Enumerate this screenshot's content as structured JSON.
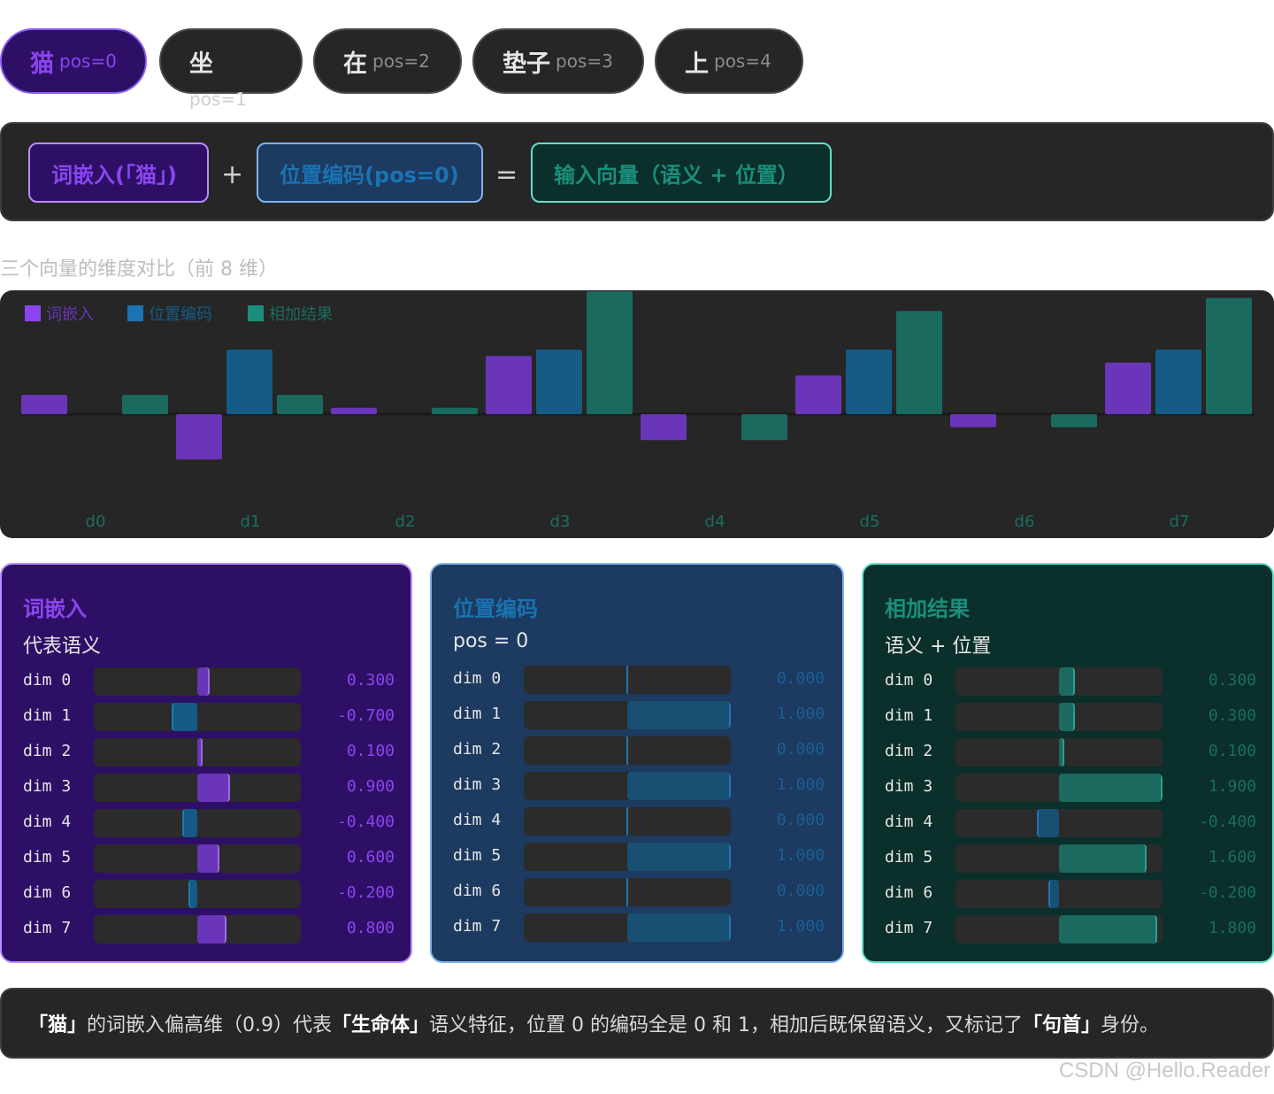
{
  "tokens": [
    {
      "char": "猫",
      "pos": "pos=0",
      "active": true
    },
    {
      "char": "坐",
      "pos": "pos=1",
      "active": false
    },
    {
      "char": "在",
      "pos": "pos=2",
      "active": false
    },
    {
      "char": "垫子",
      "pos": "pos=3",
      "active": false
    },
    {
      "char": "上",
      "pos": "pos=4",
      "active": false
    }
  ],
  "formula": {
    "word": "词嵌入(「猫」)",
    "plus": "+",
    "posenc": "位置编码(pos=0)",
    "equals": "=",
    "result": "输入向量（语义 + 位置）"
  },
  "caption": "三个向量的维度对比（前 8 维）",
  "colors": {
    "word": "#6a35b8",
    "pos": "#155b85",
    "sum": "#1b6a60"
  },
  "chart_data": {
    "type": "bar",
    "categories": [
      "d0",
      "d1",
      "d2",
      "d3",
      "d4",
      "d5",
      "d6",
      "d7"
    ],
    "series": [
      {
        "name": "词嵌入",
        "values": [
          0.3,
          -0.7,
          0.1,
          0.9,
          -0.4,
          0.6,
          -0.2,
          0.8
        ]
      },
      {
        "name": "位置编码",
        "values": [
          0.0,
          1.0,
          0.0,
          1.0,
          0.0,
          1.0,
          0.0,
          1.0
        ]
      },
      {
        "name": "相加结果",
        "values": [
          0.3,
          0.3,
          0.1,
          1.9,
          -0.4,
          1.6,
          -0.2,
          1.8
        ]
      }
    ],
    "legend": "top-left"
  },
  "cards": [
    {
      "title": "词嵌入",
      "subtitle": "代表语义",
      "rows": [
        {
          "label": "dim 0",
          "value": 0.3,
          "text": "0.300"
        },
        {
          "label": "dim 1",
          "value": -0.7,
          "text": "-0.700"
        },
        {
          "label": "dim 2",
          "value": 0.1,
          "text": "0.100"
        },
        {
          "label": "dim 3",
          "value": 0.9,
          "text": "0.900"
        },
        {
          "label": "dim 4",
          "value": -0.4,
          "text": "-0.400"
        },
        {
          "label": "dim 5",
          "value": 0.6,
          "text": "0.600"
        },
        {
          "label": "dim 6",
          "value": -0.2,
          "text": "-0.200"
        },
        {
          "label": "dim 7",
          "value": 0.8,
          "text": "0.800"
        }
      ]
    },
    {
      "title": "位置编码",
      "subtitle": "pos = 0",
      "rows": [
        {
          "label": "dim 0",
          "value": 0.0,
          "text": "0.000"
        },
        {
          "label": "dim 1",
          "value": 1.0,
          "text": "1.000"
        },
        {
          "label": "dim 2",
          "value": 0.0,
          "text": "0.000"
        },
        {
          "label": "dim 3",
          "value": 1.0,
          "text": "1.000"
        },
        {
          "label": "dim 4",
          "value": 0.0,
          "text": "0.000"
        },
        {
          "label": "dim 5",
          "value": 1.0,
          "text": "1.000"
        },
        {
          "label": "dim 6",
          "value": 0.0,
          "text": "0.000"
        },
        {
          "label": "dim 7",
          "value": 1.0,
          "text": "1.000"
        }
      ]
    },
    {
      "title": "相加结果",
      "subtitle": "语义 + 位置",
      "rows": [
        {
          "label": "dim 0",
          "value": 0.3,
          "text": "0.300"
        },
        {
          "label": "dim 1",
          "value": 0.3,
          "text": "0.300"
        },
        {
          "label": "dim 2",
          "value": 0.1,
          "text": "0.100"
        },
        {
          "label": "dim 3",
          "value": 1.9,
          "text": "1.900"
        },
        {
          "label": "dim 4",
          "value": -0.4,
          "text": "-0.400"
        },
        {
          "label": "dim 5",
          "value": 1.6,
          "text": "1.600"
        },
        {
          "label": "dim 6",
          "value": -0.2,
          "text": "-0.200"
        },
        {
          "label": "dim 7",
          "value": 1.8,
          "text": "1.800"
        }
      ]
    }
  ],
  "summary": {
    "b1": "「猫」",
    "t1": "的词嵌入偏高维（0.9）代表",
    "b2": "「生命体」",
    "t2": "语义特征，位置 0 的编码全是 0 和 1，相加后既保留语义，又标记了",
    "b3": "「句首」",
    "t3": "身份。"
  },
  "watermark": "CSDN @Hello.Reader"
}
